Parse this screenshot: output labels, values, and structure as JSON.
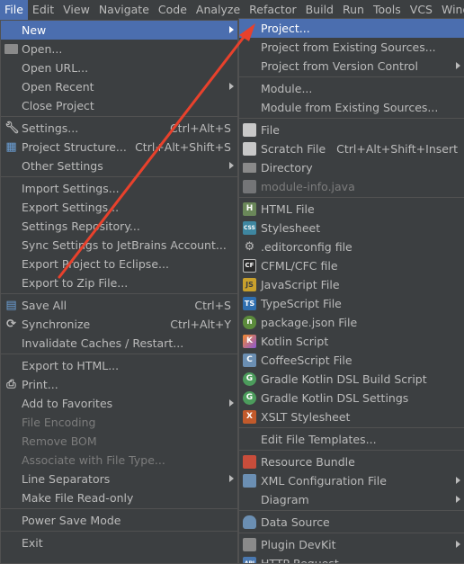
{
  "menubar": [
    "File",
    "Edit",
    "View",
    "Navigate",
    "Code",
    "Analyze",
    "Refactor",
    "Build",
    "Run",
    "Tools",
    "VCS",
    "Wind"
  ],
  "file_menu": {
    "new": "New",
    "open": "Open...",
    "open_url": "Open URL...",
    "open_recent": "Open Recent",
    "close_project": "Close Project",
    "settings": "Settings...",
    "settings_sc": "Ctrl+Alt+S",
    "project_structure": "Project Structure...",
    "project_structure_sc": "Ctrl+Alt+Shift+S",
    "other_settings": "Other Settings",
    "import_settings": "Import Settings...",
    "export_settings": "Export Settings...",
    "settings_repository": "Settings Repository...",
    "sync_settings": "Sync Settings to JetBrains Account...",
    "export_eclipse": "Export Project to Eclipse...",
    "export_zip": "Export to Zip File...",
    "save_all": "Save All",
    "save_all_sc": "Ctrl+S",
    "synchronize": "Synchronize",
    "synchronize_sc": "Ctrl+Alt+Y",
    "invalidate": "Invalidate Caches / Restart...",
    "export_html": "Export to HTML...",
    "print": "Print...",
    "add_favorites": "Add to Favorites",
    "file_encoding": "File Encoding",
    "remove_bom": "Remove BOM",
    "associate": "Associate with File Type...",
    "line_separators": "Line Separators",
    "make_readonly": "Make File Read-only",
    "power_save": "Power Save Mode",
    "exit": "Exit"
  },
  "new_menu": {
    "project": "Project...",
    "project_existing": "Project from Existing Sources...",
    "project_vcs": "Project from Version Control",
    "module": "Module...",
    "module_existing": "Module from Existing Sources...",
    "file": "File",
    "scratch": "Scratch File",
    "scratch_sc": "Ctrl+Alt+Shift+Insert",
    "directory": "Directory",
    "module_info": "module-info.java",
    "html_file": "HTML File",
    "stylesheet": "Stylesheet",
    "editorconfig": ".editorconfig file",
    "cfml": "CFML/CFC file",
    "js_file": "JavaScript File",
    "ts_file": "TypeScript File",
    "package_json": "package.json File",
    "kotlin_script": "Kotlin Script",
    "coffee_file": "CoffeeScript File",
    "gradle_build": "Gradle Kotlin DSL Build Script",
    "gradle_settings": "Gradle Kotlin DSL Settings",
    "xslt": "XSLT Stylesheet",
    "edit_templates": "Edit File Templates...",
    "resource_bundle": "Resource Bundle",
    "xml_config": "XML Configuration File",
    "diagram": "Diagram",
    "data_source": "Data Source",
    "plugin_devkit": "Plugin DevKit",
    "http_request": "HTTP Request"
  },
  "icons": {
    "html": "H",
    "css": "CSS",
    "cfml": "CF",
    "js": "JS",
    "ts": "TS",
    "npm": "n",
    "kt": "K",
    "coffee": "C",
    "gradle": "G",
    "xslt": "X",
    "api": "API"
  },
  "colors": {
    "selection": "#4b6eaf",
    "background": "#3c3f41",
    "arrow": "#e8412c"
  }
}
